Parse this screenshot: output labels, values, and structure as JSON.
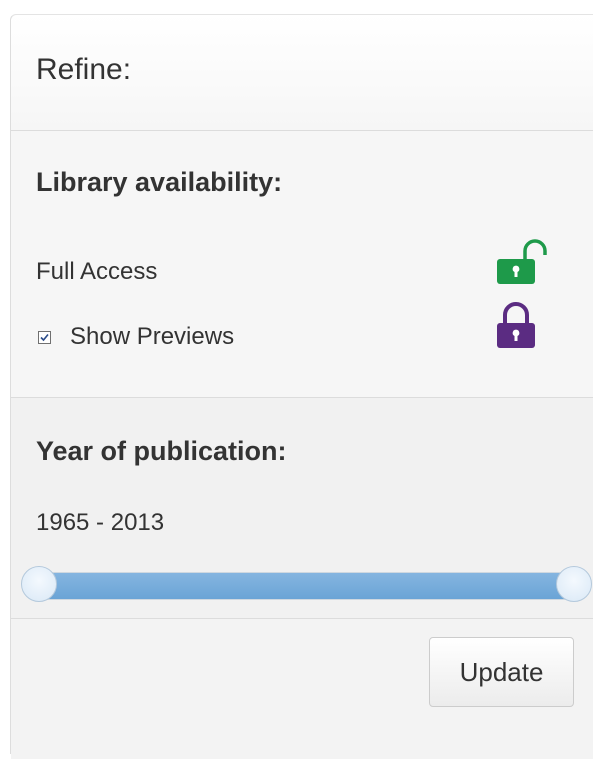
{
  "refine": {
    "title": "Refine:"
  },
  "library_availability": {
    "title": "Library availability:",
    "full_access_label": "Full Access",
    "full_access_icon": "unlocked-padlock-icon",
    "full_access_icon_color": "#1e9a4a",
    "show_previews_label": "Show Previews",
    "show_previews_checked": true,
    "show_previews_icon": "padlock-icon",
    "show_previews_icon_color": "#5b2c82"
  },
  "year_of_publication": {
    "title": "Year of publication:",
    "range_text": "1965 - 2013",
    "min_year": 1965,
    "max_year": 2013,
    "selected_from": 1965,
    "selected_to": 2013,
    "slider_fill_color": "#6ba4d6"
  },
  "footer": {
    "update_label": "Update"
  }
}
